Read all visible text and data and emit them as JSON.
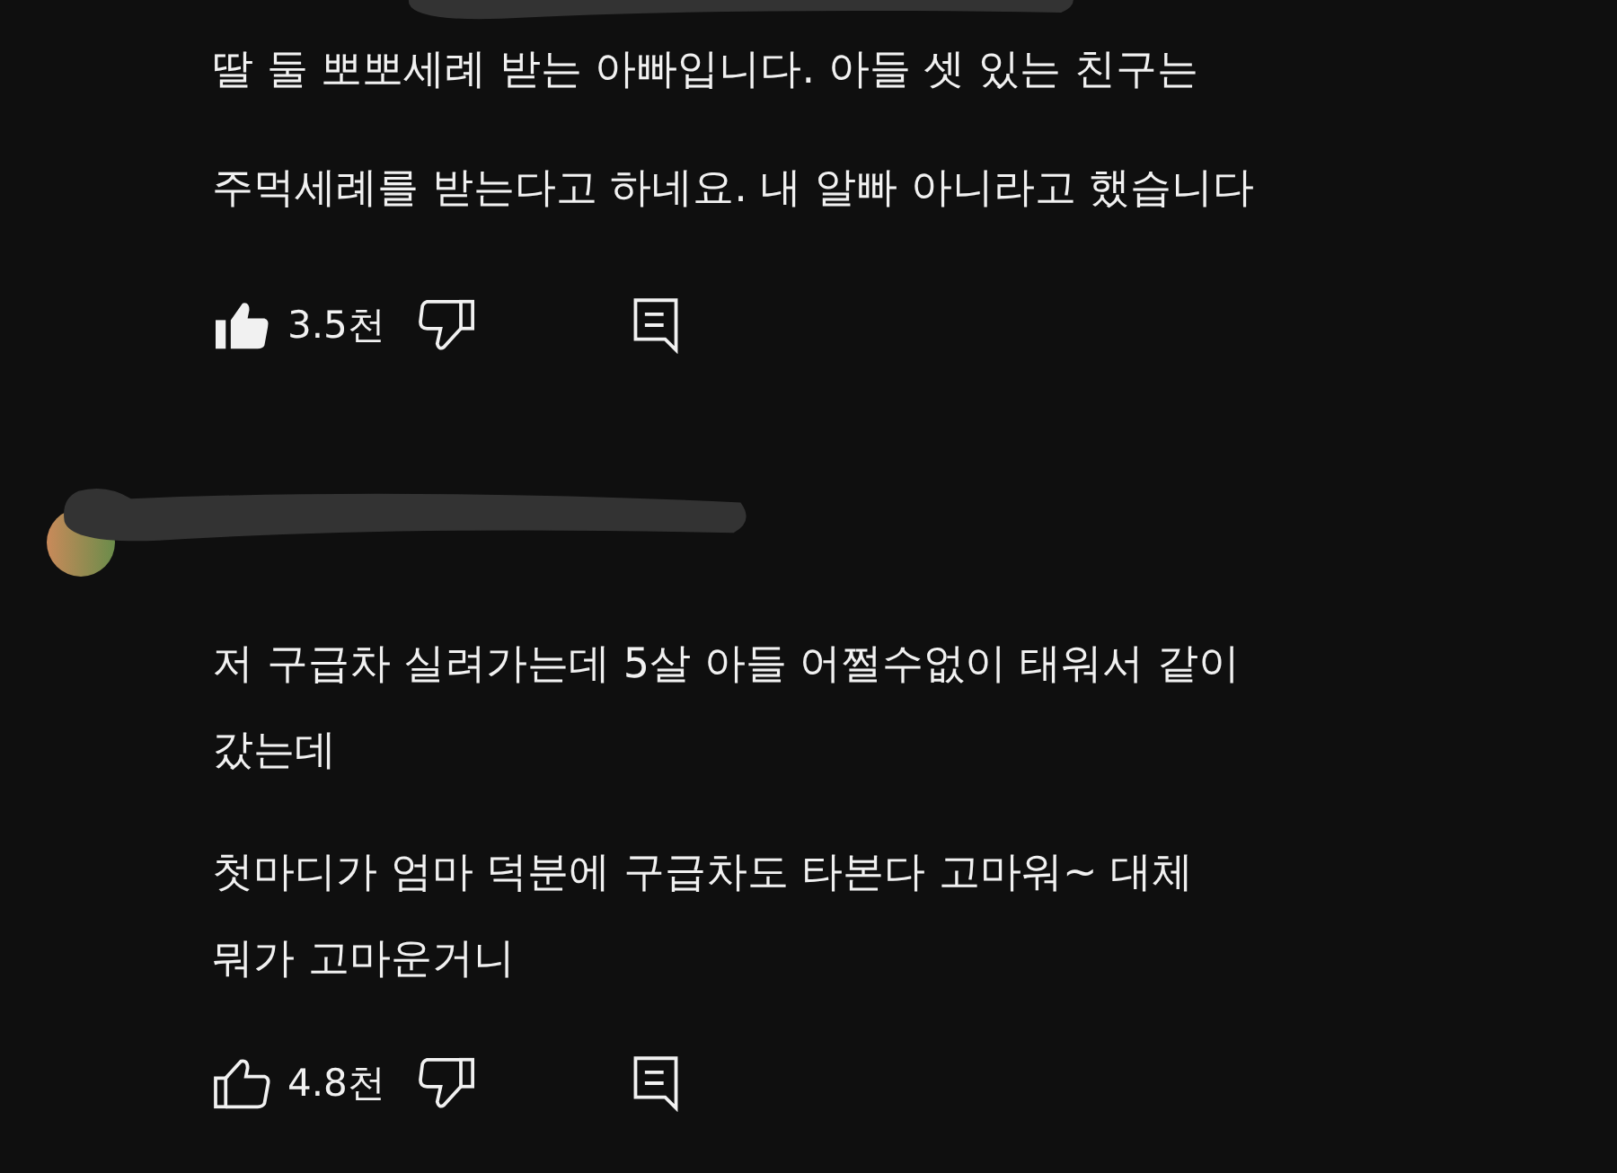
{
  "comments": [
    {
      "redacted_header": true,
      "lines": [
        "딸 둘 뽀뽀세례 받는 아빠입니다. 아들 셋 있는 친구는",
        "주먹세례를 받는다고 하네요. 내 알빠 아니라고 했습니다"
      ],
      "likes": "3.5천",
      "liked": true
    },
    {
      "redacted_header": true,
      "avatar": true,
      "lines": [
        "저 구급차 실려가는데 5살 아들 어쩔수없이 태워서 같이",
        "갔는데",
        "첫마디가 엄마 덕분에 구급차도 타본다 고마워~  대체",
        "뭐가 고마운거니"
      ],
      "likes": "4.8천",
      "liked": false
    }
  ]
}
